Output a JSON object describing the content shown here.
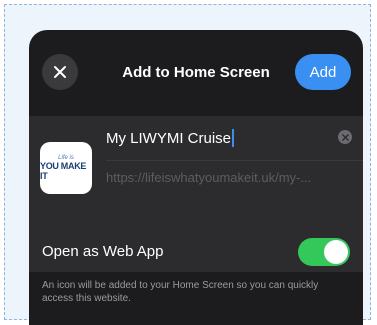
{
  "header": {
    "title": "Add to Home Screen",
    "add_label": "Add"
  },
  "bookmark": {
    "icon_text_small": "Life is",
    "icon_text_big": "YOU MAKE IT",
    "name": "My LIWYMI Cruise",
    "url": "https://lifeiswhatyoumakeit.uk/my-..."
  },
  "web_app": {
    "label": "Open as Web App",
    "enabled": true,
    "note": "An icon will be added to your Home Screen so you can quickly access this website."
  },
  "colors": {
    "accent": "#3a8ff2",
    "toggle_on": "#34c759",
    "sheet_bg": "#1c1c1e"
  },
  "icons": [
    "close-icon",
    "clear-icon"
  ]
}
